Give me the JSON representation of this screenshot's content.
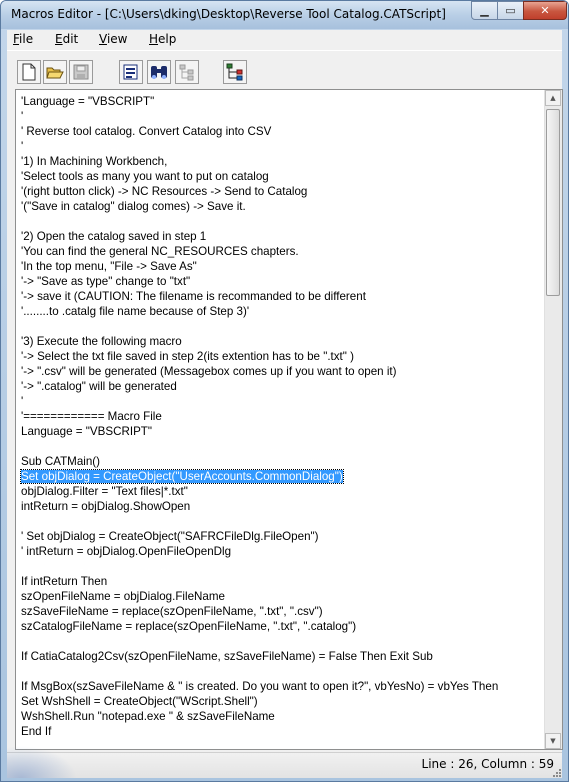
{
  "window": {
    "title": "Macros Editor - [C:\\Users\\dking\\Desktop\\Reverse Tool Catalog.CATScript]",
    "minimize_icon": "minimize-icon",
    "maximize_icon": "maximize-icon",
    "close_icon": "close-icon",
    "min_glyph": "▁",
    "max_glyph": "▭",
    "close_glyph": "✕"
  },
  "menu": {
    "file_hot": "F",
    "file_rest": "ile",
    "edit_hot": "E",
    "edit_rest": "dit",
    "view_hot": "V",
    "view_rest": "iew",
    "help_hot": "H",
    "help_rest": "elp"
  },
  "toolbar": {
    "icons": [
      "new-document-icon",
      "open-folder-icon",
      "save-icon",
      "properties-icon",
      "find-icon",
      "tree-disabled-icon",
      "object-browser-icon"
    ]
  },
  "editor": {
    "selected_line": 25,
    "lines": [
      "'Language = \"VBSCRIPT\"",
      "'",
      "' Reverse tool catalog. Convert Catalog into CSV",
      "'",
      "'1) In Machining Workbench,",
      "'Select tools as many you want to put on catalog",
      "'(right button click) -> NC Resources -> Send to Catalog",
      "'(\"Save in catalog\" dialog comes) -> Save it.",
      "",
      "'2) Open the catalog saved in step 1",
      "'You can find the general NC_RESOURCES chapters.",
      "'In the top menu, \"File -> Save As\"",
      "'-> \"Save as type\" change to \"txt\"",
      "'-> save it (CAUTION: The filename is recommanded to be different",
      "'........to .catalg file name because of Step 3)'",
      "",
      "'3) Execute the following macro",
      "'-> Select the txt file saved in step 2(its extention has to be \".txt\" )",
      "'-> \".csv\" will be generated (Messagebox comes up if you want to open it)",
      "'-> \".catalog\" will be generated",
      "'",
      "'============ Macro File",
      "Language = \"VBSCRIPT\"",
      "",
      "Sub CATMain()",
      "Set objDialog = CreateObject(\"UserAccounts.CommonDialog\")",
      "objDialog.Filter = \"Text files|*.txt\"",
      "intReturn = objDialog.ShowOpen",
      "",
      "' Set objDialog = CreateObject(\"SAFRCFileDlg.FileOpen\")",
      "' intReturn = objDialog.OpenFileOpenDlg",
      "",
      "If intReturn Then",
      "szOpenFileName = objDialog.FileName",
      "szSaveFileName = replace(szOpenFileName, \".txt\", \".csv\")",
      "szCatalogFileName = replace(szOpenFileName, \".txt\", \".catalog\")",
      "",
      "If CatiaCatalog2Csv(szOpenFileName, szSaveFileName) = False Then Exit Sub",
      "",
      "If MsgBox(szSaveFileName & \" is created. Do you want to open it?\", vbYesNo) = vbYes Then",
      "Set WshShell = CreateObject(\"WScript.Shell\")",
      "WshShell.Run \"notepad.exe \" & szSaveFileName",
      "End If"
    ]
  },
  "scrollbar": {
    "up_glyph": "▲",
    "down_glyph": "▼"
  },
  "status": {
    "position": "Line : 26, Column : 59"
  },
  "colors": {
    "selection": "#3399ff",
    "title_bar": "#b9cfe6",
    "close_button": "#c8563f"
  }
}
